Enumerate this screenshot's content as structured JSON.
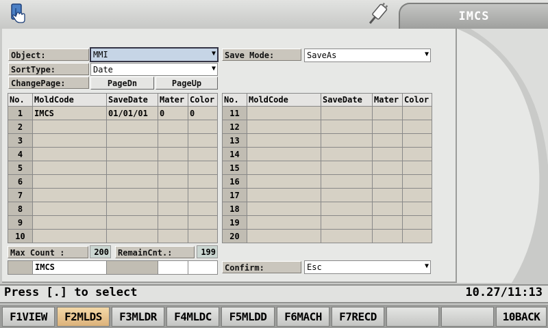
{
  "title": "IMCS",
  "icons": {
    "hand": "pointing-hand-icon",
    "plug": "connection-plug-icon"
  },
  "colors": {
    "accent_selected": "#c6d5e6",
    "row_bg": "#d6d1c5",
    "active_fkey": "#dcb27a"
  },
  "form": {
    "object_label": "Object:",
    "object_value": "MMI",
    "sorttype_label": "SortType:",
    "sorttype_value": "Date",
    "changepage_label": "ChangePage:",
    "pagedn": "PageDn",
    "pageup": "PageUp",
    "savemode_label": "Save Mode:",
    "savemode_value": "SaveAs"
  },
  "tables": {
    "headers": [
      "No.",
      "MoldCode",
      "SaveDate",
      "Mater",
      "Color"
    ],
    "left_rows": [
      {
        "no": "1",
        "mold": "IMCS",
        "date": "01/01/01",
        "mater": "0",
        "color": "0"
      },
      {
        "no": "2",
        "mold": "",
        "date": "",
        "mater": "",
        "color": ""
      },
      {
        "no": "3",
        "mold": "",
        "date": "",
        "mater": "",
        "color": ""
      },
      {
        "no": "4",
        "mold": "",
        "date": "",
        "mater": "",
        "color": ""
      },
      {
        "no": "5",
        "mold": "",
        "date": "",
        "mater": "",
        "color": ""
      },
      {
        "no": "6",
        "mold": "",
        "date": "",
        "mater": "",
        "color": ""
      },
      {
        "no": "7",
        "mold": "",
        "date": "",
        "mater": "",
        "color": ""
      },
      {
        "no": "8",
        "mold": "",
        "date": "",
        "mater": "",
        "color": ""
      },
      {
        "no": "9",
        "mold": "",
        "date": "",
        "mater": "",
        "color": ""
      },
      {
        "no": "10",
        "mold": "",
        "date": "",
        "mater": "",
        "color": ""
      }
    ],
    "right_rows": [
      {
        "no": "11",
        "mold": "",
        "date": "",
        "mater": "",
        "color": ""
      },
      {
        "no": "12",
        "mold": "",
        "date": "",
        "mater": "",
        "color": ""
      },
      {
        "no": "13",
        "mold": "",
        "date": "",
        "mater": "",
        "color": ""
      },
      {
        "no": "14",
        "mold": "",
        "date": "",
        "mater": "",
        "color": ""
      },
      {
        "no": "15",
        "mold": "",
        "date": "",
        "mater": "",
        "color": ""
      },
      {
        "no": "16",
        "mold": "",
        "date": "",
        "mater": "",
        "color": ""
      },
      {
        "no": "17",
        "mold": "",
        "date": "",
        "mater": "",
        "color": ""
      },
      {
        "no": "18",
        "mold": "",
        "date": "",
        "mater": "",
        "color": ""
      },
      {
        "no": "19",
        "mold": "",
        "date": "",
        "mater": "",
        "color": ""
      },
      {
        "no": "20",
        "mold": "",
        "date": "",
        "mater": "",
        "color": ""
      }
    ]
  },
  "counts": {
    "max_label": "Max Count :",
    "max_value": "200",
    "remain_label": "RemainCnt.:",
    "remain_value": "199"
  },
  "input_row": {
    "mold": "IMCS"
  },
  "confirm": {
    "label": "Confirm:",
    "value": "Esc"
  },
  "status": {
    "message": "Press [.] to select",
    "datetime": "10.27/11:13"
  },
  "fkeys": [
    "F1VIEW",
    "F2MLDS",
    "F3MLDR",
    "F4MLDC",
    "F5MLDD",
    "F6MACH",
    "F7RECD",
    "",
    "",
    "10BACK"
  ]
}
